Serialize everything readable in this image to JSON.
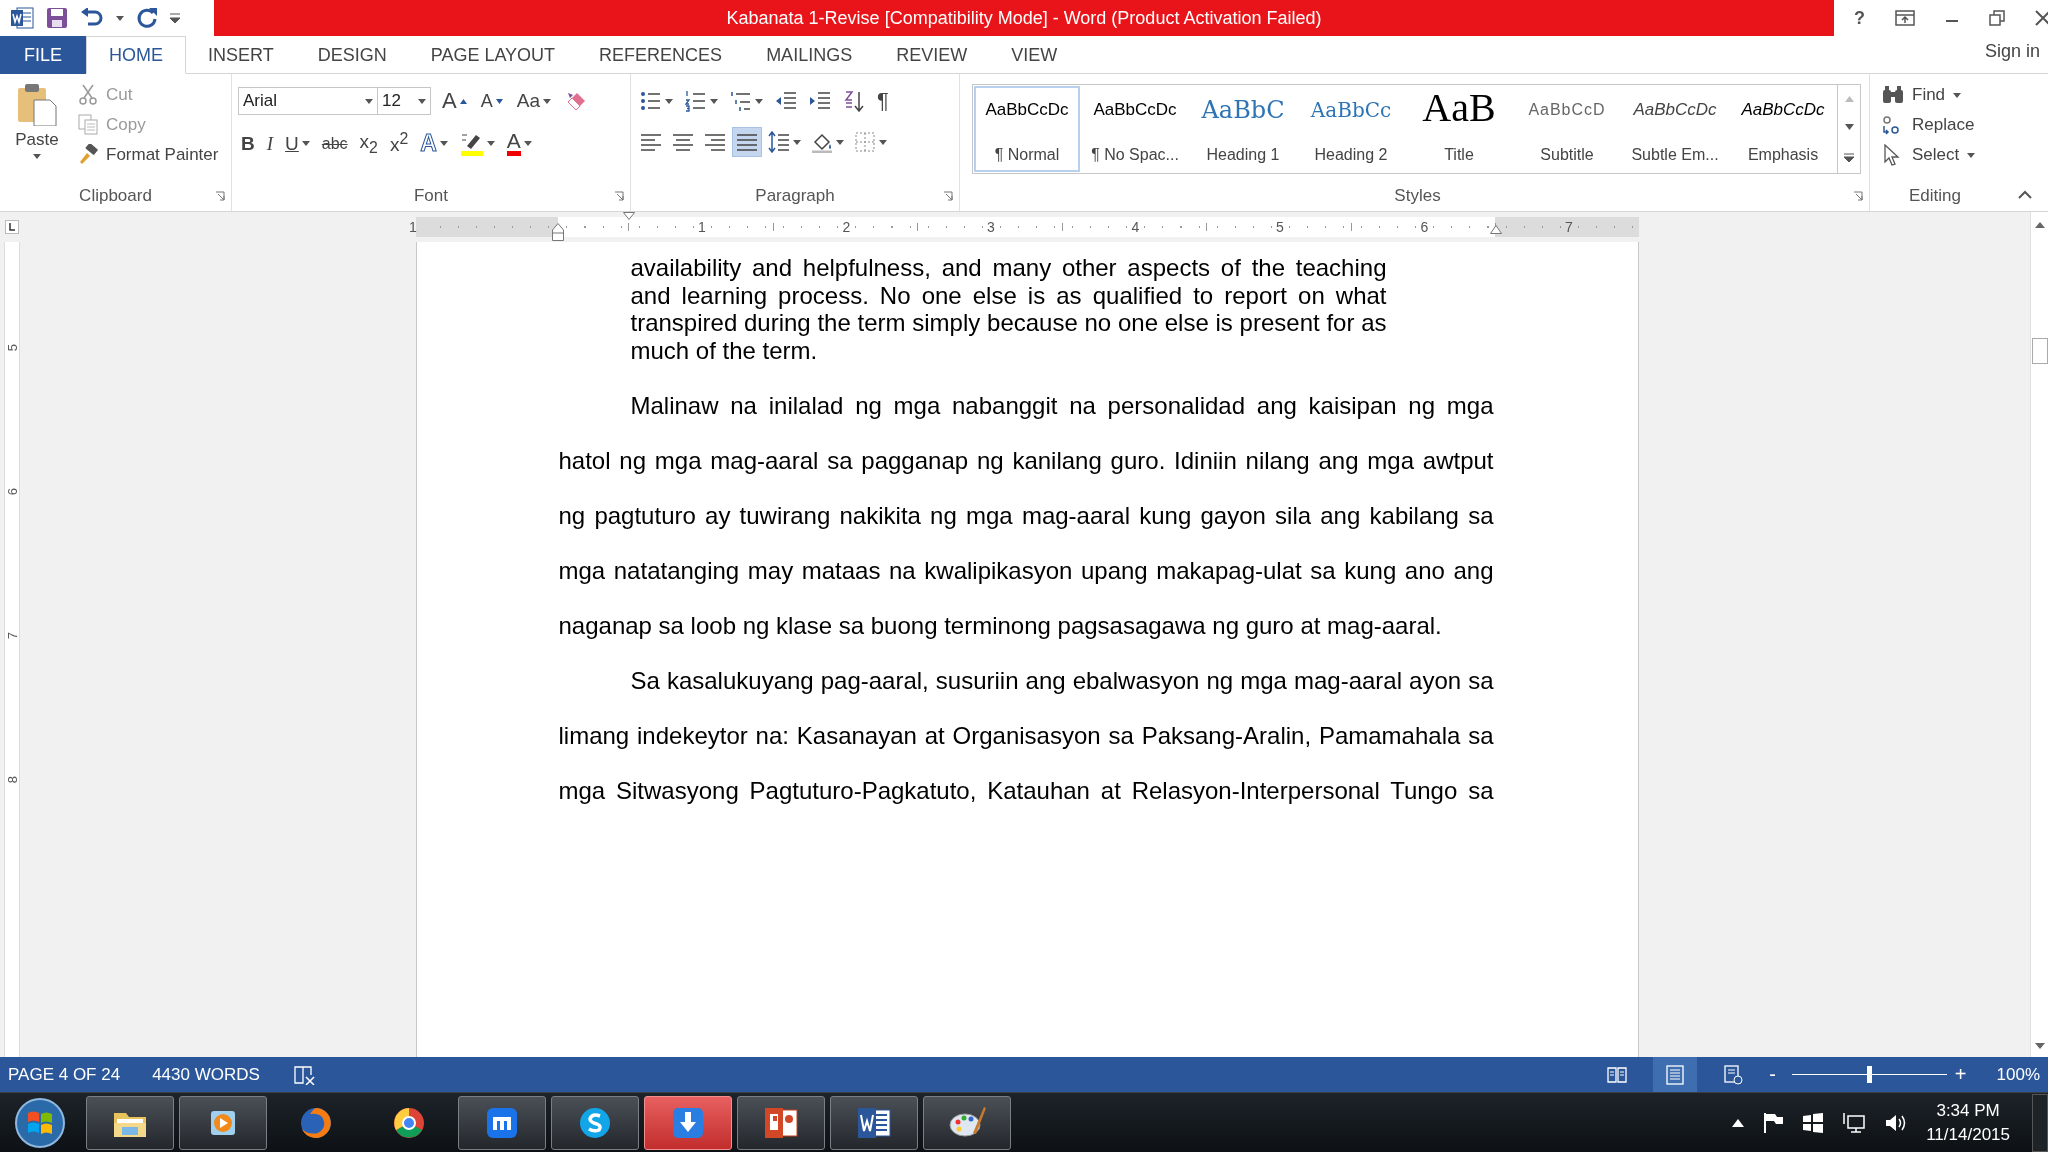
{
  "window": {
    "title": "Kabanata 1-Revise [Compatibility Mode] - Word (Product Activation Failed)",
    "help": "?"
  },
  "ribbon_tabs": [
    {
      "label": "FILE",
      "kind": "file",
      "selected": false
    },
    {
      "label": "HOME",
      "kind": "tab",
      "selected": true
    },
    {
      "label": "INSERT",
      "kind": "tab",
      "selected": false
    },
    {
      "label": "DESIGN",
      "kind": "tab",
      "selected": false
    },
    {
      "label": "PAGE LAYOUT",
      "kind": "tab",
      "selected": false
    },
    {
      "label": "REFERENCES",
      "kind": "tab",
      "selected": false
    },
    {
      "label": "MAILINGS",
      "kind": "tab",
      "selected": false
    },
    {
      "label": "REVIEW",
      "kind": "tab",
      "selected": false
    },
    {
      "label": "VIEW",
      "kind": "tab",
      "selected": false
    }
  ],
  "account": {
    "label": "Sign in"
  },
  "clipboard": {
    "title": "Clipboard",
    "paste": "Paste",
    "commands": [
      {
        "label": "Cut",
        "kind": "cut",
        "disabled": true
      },
      {
        "label": "Copy",
        "kind": "copy",
        "disabled": true
      },
      {
        "label": "Format Painter",
        "kind": "painter",
        "disabled": false
      }
    ]
  },
  "font": {
    "title": "Font",
    "name": "Arial",
    "size": "12",
    "row_1": [
      {
        "kind": "grow",
        "glyph": "A"
      },
      {
        "kind": "shrink",
        "glyph": "A"
      },
      {
        "kind": "case",
        "glyph": "Aa"
      },
      {
        "kind": "clear"
      }
    ],
    "row_2": [
      {
        "kind": "bold",
        "glyph": "B"
      },
      {
        "kind": "italic",
        "glyph": "I"
      },
      {
        "kind": "underline",
        "glyph": "U"
      },
      {
        "kind": "strike",
        "glyph": "abc"
      },
      {
        "kind": "subscript",
        "glyph": "x$_{2}$"
      },
      {
        "kind": "superscript",
        "glyph": "x$^{2}$"
      },
      {
        "kind": "effects",
        "glyph": "A"
      },
      {
        "kind": "highlight"
      },
      {
        "kind": "color",
        "glyph": "A"
      }
    ]
  },
  "paragraph": {
    "title": "Paragraph",
    "row_1": [
      {
        "kind": "bullets"
      },
      {
        "kind": "numbering"
      },
      {
        "kind": "multilevel"
      },
      {
        "kind": "outdent"
      },
      {
        "kind": "indent"
      },
      {
        "kind": "sort"
      },
      {
        "kind": "marks",
        "glyph": "¶"
      }
    ],
    "alignment": [
      {
        "kind": "left",
        "selected": false
      },
      {
        "kind": "center",
        "selected": false
      },
      {
        "kind": "right",
        "selected": false
      },
      {
        "kind": "justify",
        "selected": true
      }
    ],
    "row_2": [
      {
        "kind": "spacing"
      },
      {
        "kind": "shading"
      },
      {
        "kind": "borders"
      }
    ]
  },
  "styles": {
    "title": "Styles",
    "items": [
      {
        "preview": "AaBbCcDc",
        "label": "¶ Normal",
        "kind": "normal",
        "selected": true
      },
      {
        "preview": "AaBbCcDc",
        "label": "¶ No Spac...",
        "kind": "normal",
        "selected": false
      },
      {
        "preview": "AaBbC",
        "label": "Heading 1",
        "kind": "heading1",
        "selected": false
      },
      {
        "preview": "AaBbCc",
        "label": "Heading 2",
        "kind": "heading2",
        "selected": false
      },
      {
        "preview": "AaB",
        "label": "Title",
        "kind": "title",
        "selected": false
      },
      {
        "preview": "AaBbCcD",
        "label": "Subtitle",
        "kind": "subtitle",
        "selected": false
      },
      {
        "preview": "AaBbCcDc",
        "label": "Subtle Em...",
        "kind": "subtle",
        "selected": false
      },
      {
        "preview": "AaBbCcDc",
        "label": "Emphasis",
        "kind": "emphasis",
        "selected": false
      }
    ]
  },
  "editing": {
    "title": "Editing",
    "commands": [
      {
        "label": "Find",
        "kind": "find"
      },
      {
        "label": "Replace",
        "kind": "replace"
      },
      {
        "label": "Select",
        "kind": "select"
      }
    ]
  },
  "ruler": {
    "numbers": [
      "1",
      "1",
      "2",
      "3",
      "4",
      "5",
      "6",
      "7"
    ]
  },
  "vertical_ruler": {
    "numbers": [
      "5",
      "6",
      "7",
      "8"
    ]
  },
  "document": {
    "paragraphs": [
      {
        "kind": "quote",
        "continues": false,
        "text": "availability and helpfulness, and many other aspects of the teaching and learning process. No one else is as qualified to report on what transpired during the term simply because no one else is present for as much of the term."
      },
      {
        "kind": "body",
        "continues": false,
        "text": "Malinaw na inilalad ng mga nabanggit na personalidad ang kaisipan ng mga hatol ng mga mag-aaral sa pagganap ng kanilang guro. Idiniin nilang ang mga awtput ng pagtuturo ay tuwirang nakikita ng mga mag-aaral kung gayon sila ang kabilang sa mga natatanging may mataas na kwalipikasyon upang makapag-ulat sa kung ano ang naganap sa loob ng klase sa buong terminong pagsasagawa ng guro at mag-aaral."
      },
      {
        "kind": "body",
        "continues": true,
        "text": "Sa kasalukuyang pag-aaral, susuriin ang ebalwasyon ng mga mag-aaral ayon sa limang indekeytor na: Kasanayan at Organisasyon sa Paksang-Aralin, Pamamahala sa mga Sitwasyong Pagtuturo-Pagkatuto, Katauhan at Relasyon-Interpersonal Tungo sa"
      }
    ]
  },
  "status_bar": {
    "page": "PAGE 4 OF 24",
    "words": "4430 WORDS",
    "views": [
      {
        "kind": "read",
        "selected": false
      },
      {
        "kind": "print",
        "selected": true
      },
      {
        "kind": "web",
        "selected": false
      }
    ],
    "zoom": {
      "minus": "-",
      "plus": "+",
      "level": 0.5,
      "reading": "100%"
    }
  },
  "taskbar": {
    "apps": [
      {
        "kind": "folder",
        "running": true,
        "attention": false
      },
      {
        "kind": "media",
        "running": true,
        "attention": false
      },
      {
        "kind": "globe",
        "running": false,
        "attention": false
      },
      {
        "kind": "ring",
        "running": false,
        "attention": false
      },
      {
        "kind": "bridge",
        "running": true,
        "attention": false
      },
      {
        "kind": "chat",
        "running": true,
        "attention": false
      },
      {
        "kind": "download",
        "running": true,
        "attention": true
      },
      {
        "kind": "slides",
        "running": true,
        "attention": false
      },
      {
        "kind": "word",
        "running": true,
        "attention": false
      },
      {
        "kind": "paint",
        "running": true,
        "attention": false
      }
    ],
    "clock": {
      "time": "3:34 PM",
      "date": "11/14/2015"
    }
  }
}
